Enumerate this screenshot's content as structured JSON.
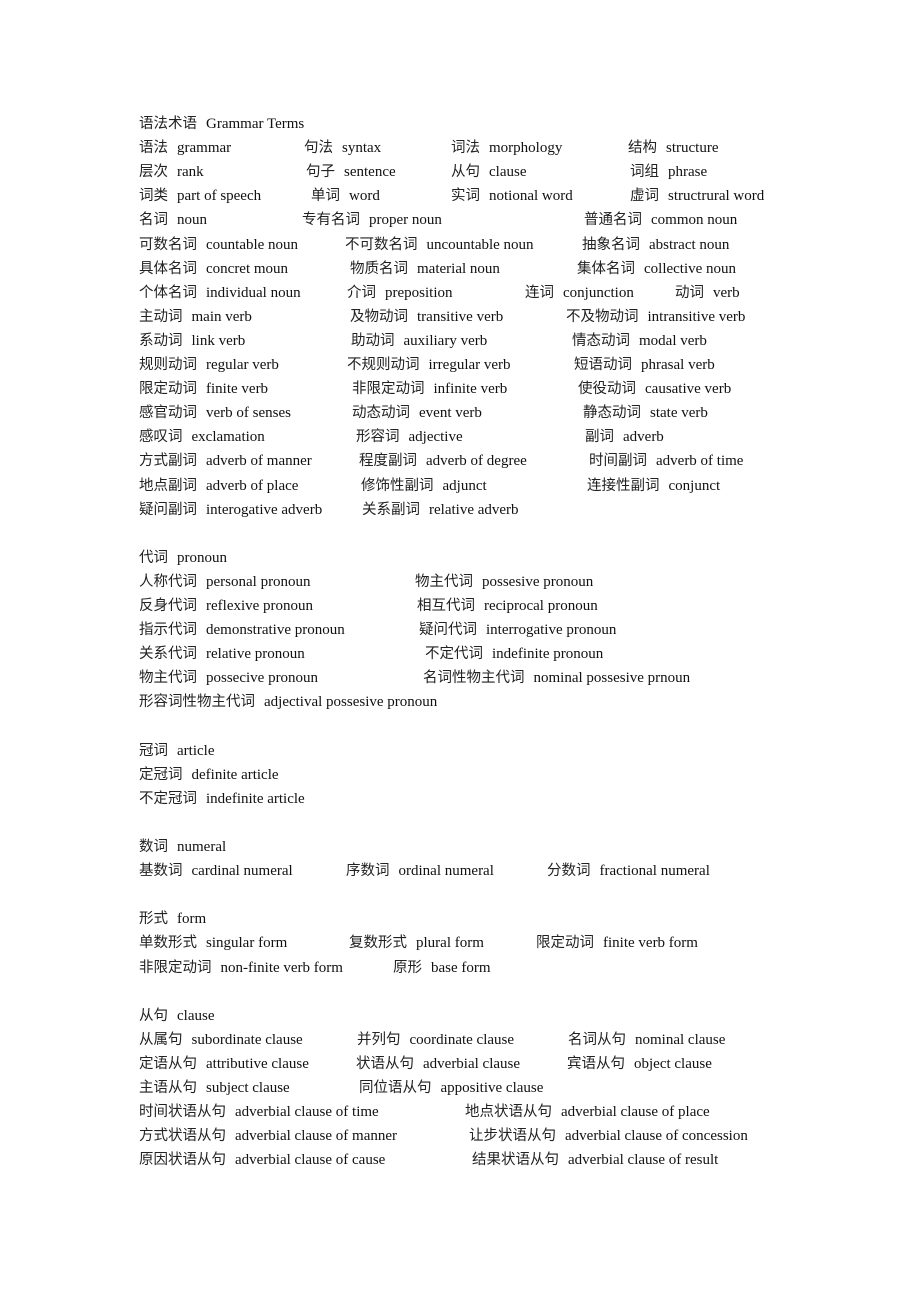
{
  "document": {
    "lines": [
      [
        {
          "zh": "语法术语",
          "en": "Grammar Terms"
        }
      ],
      [
        {
          "zh": "语法",
          "en": "grammar"
        },
        {
          "zh": "句法",
          "en": "syntax"
        },
        {
          "zh": "词法",
          "en": "morphology"
        },
        {
          "zh": "结构",
          "en": "structure"
        }
      ],
      [
        {
          "zh": "层次",
          "en": "rank"
        },
        {
          "zh": "句子",
          "en": "sentence"
        },
        {
          "zh": "从句",
          "en": "clause"
        },
        {
          "zh": "词组",
          "en": "phrase"
        }
      ],
      [
        {
          "zh": "词类",
          "en": "part of speech"
        },
        {
          "zh": "单词",
          "en": "word"
        },
        {
          "zh": "实词",
          "en": "notional word"
        },
        {
          "zh": "虚词",
          "en": "structrural word"
        }
      ],
      [
        {
          "zh": "名词",
          "en": "noun"
        },
        {
          "zh": "专有名词",
          "en": "proper noun"
        },
        {
          "zh": "普通名词",
          "en": "common noun"
        }
      ],
      [
        {
          "zh": "可数名词",
          "en": "countable noun"
        },
        {
          "zh": "不可数名词",
          "en": "uncountable noun"
        },
        {
          "zh": "抽象名词",
          "en": "abstract noun"
        }
      ],
      [
        {
          "zh": "具体名词",
          "en": "concret moun"
        },
        {
          "zh": "物质名词",
          "en": "material noun"
        },
        {
          "zh": "集体名词",
          "en": "collective noun"
        }
      ],
      [
        {
          "zh": "个体名词",
          "en": "individual noun"
        },
        {
          "zh": "介词",
          "en": "preposition"
        },
        {
          "zh": "连词",
          "en": "conjunction"
        },
        {
          "zh": "动词",
          "en": "verb"
        }
      ],
      [
        {
          "zh": "主动词",
          "en": "main verb"
        },
        {
          "zh": "及物动词",
          "en": "transitive verb"
        },
        {
          "zh": "不及物动词",
          "en": "intransitive verb"
        }
      ],
      [
        {
          "zh": "系动词",
          "en": "link verb"
        },
        {
          "zh": "助动词",
          "en": "auxiliary verb"
        },
        {
          "zh": "情态动词",
          "en": "modal verb"
        }
      ],
      [
        {
          "zh": "规则动词",
          "en": "regular verb"
        },
        {
          "zh": "不规则动词",
          "en": "irregular verb"
        },
        {
          "zh": "短语动词",
          "en": "phrasal verb"
        }
      ],
      [
        {
          "zh": "限定动词",
          "en": "finite verb"
        },
        {
          "zh": "非限定动词",
          "en": "infinite verb"
        },
        {
          "zh": "使役动词",
          "en": "causative verb"
        }
      ],
      [
        {
          "zh": "感官动词",
          "en": "verb of senses"
        },
        {
          "zh": "动态动词",
          "en": "event verb"
        },
        {
          "zh": "静态动词",
          "en": "state verb"
        }
      ],
      [
        {
          "zh": "感叹词",
          "en": "exclamation"
        },
        {
          "zh": "形容词",
          "en": "adjective"
        },
        {
          "zh": "副词",
          "en": "adverb"
        }
      ],
      [
        {
          "zh": "方式副词",
          "en": "adverb of manner"
        },
        {
          "zh": "程度副词",
          "en": "adverb of degree"
        },
        {
          "zh": "时间副词",
          "en": "adverb of time"
        }
      ],
      [
        {
          "zh": "地点副词",
          "en": "adverb of place"
        },
        {
          "zh": "修饰性副词",
          "en": "adjunct"
        },
        {
          "zh": "连接性副词",
          "en": "conjunct"
        }
      ],
      [
        {
          "zh": "疑问副词",
          "en": "interogative adverb"
        },
        {
          "zh": "关系副词",
          "en": "relative adverb"
        }
      ],
      [],
      [
        {
          "zh": "代词",
          "en": "pronoun"
        }
      ],
      [
        {
          "zh": "人称代词",
          "en": "personal pronoun"
        },
        {
          "zh": "物主代词",
          "en": "possesive pronoun"
        }
      ],
      [
        {
          "zh": "反身代词",
          "en": "reflexive pronoun"
        },
        {
          "zh": "相互代词",
          "en": "reciprocal pronoun"
        }
      ],
      [
        {
          "zh": "指示代词",
          "en": "demonstrative pronoun"
        },
        {
          "zh": "疑问代词",
          "en": "interrogative pronoun"
        }
      ],
      [
        {
          "zh": "关系代词",
          "en": "relative pronoun"
        },
        {
          "zh": "不定代词",
          "en": "indefinite pronoun"
        }
      ],
      [
        {
          "zh": "物主代词",
          "en": "possecive pronoun"
        },
        {
          "zh": "名词性物主代词",
          "en": "nominal possesive prnoun"
        }
      ],
      [
        {
          "zh": "形容词性物主代词",
          "en": "adjectival possesive pronoun"
        }
      ],
      [],
      [
        {
          "zh": "冠词",
          "en": "article"
        }
      ],
      [
        {
          "zh": "定冠词",
          "en": "definite article"
        }
      ],
      [
        {
          "zh": "不定冠词",
          "en": "indefinite article"
        }
      ],
      [],
      [
        {
          "zh": "数词",
          "en": "numeral"
        }
      ],
      [
        {
          "zh": "基数词",
          "en": "cardinal numeral"
        },
        {
          "zh": "序数词",
          "en": "ordinal numeral"
        },
        {
          "zh": "分数词",
          "en": "fractional numeral"
        }
      ],
      [],
      [
        {
          "zh": "形式",
          "en": "form"
        }
      ],
      [
        {
          "zh": "单数形式",
          "en": "singular form"
        },
        {
          "zh": "复数形式",
          "en": "plural form"
        },
        {
          "zh": "限定动词",
          "en": "finite verb form"
        }
      ],
      [
        {
          "zh": "非限定动词",
          "en": "non-finite verb form"
        },
        {
          "zh": "原形",
          "en": "base form"
        }
      ],
      [],
      [
        {
          "zh": "从句",
          "en": "clause"
        }
      ],
      [
        {
          "zh": "从属句",
          "en": "subordinate clause"
        },
        {
          "zh": "并列句",
          "en": "coordinate clause"
        },
        {
          "zh": "名词从句",
          "en": "nominal clause"
        }
      ],
      [
        {
          "zh": "定语从句",
          "en": "attributive clause"
        },
        {
          "zh": "状语从句",
          "en": "adverbial clause"
        },
        {
          "zh": "宾语从句",
          "en": "object clause"
        }
      ],
      [
        {
          "zh": "主语从句",
          "en": "subject clause"
        },
        {
          "zh": "同位语从句",
          "en": "appositive clause"
        }
      ],
      [
        {
          "zh": "时间状语从句",
          "en": "adverbial clause of time"
        },
        {
          "zh": "地点状语从句",
          "en": "adverbial clause of place"
        }
      ],
      [
        {
          "zh": "方式状语从句",
          "en": "adverbial clause of manner"
        },
        {
          "zh": "让步状语从句",
          "en": "adverbial clause of concession"
        }
      ],
      [
        {
          "zh": "原因状语从句",
          "en": "adverbial clause of cause"
        },
        {
          "zh": "结果状语从句",
          "en": "adverbial clause of result"
        }
      ]
    ]
  }
}
